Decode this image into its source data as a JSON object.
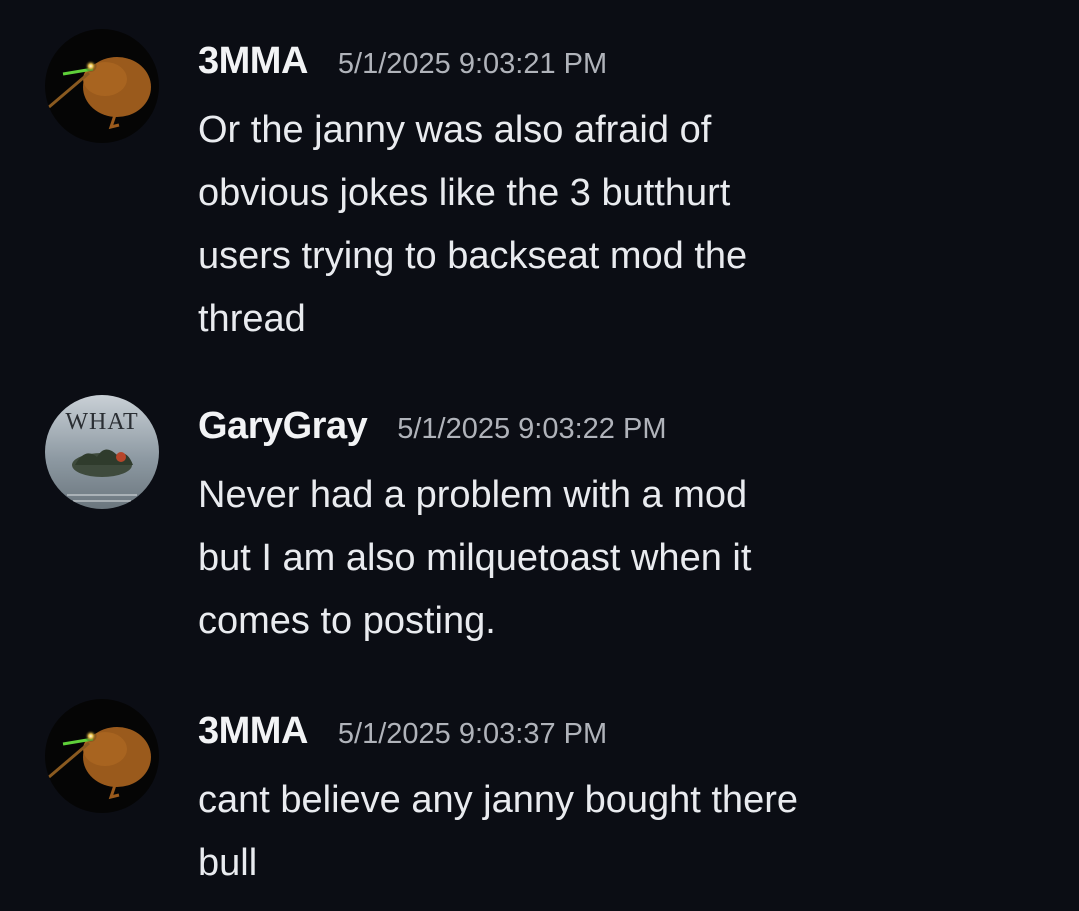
{
  "messages": [
    {
      "username": "3MMA",
      "timestamp": "5/1/2025 9:03:21 PM",
      "avatar_icon": "kiwi-bird-avatar-icon",
      "lines": [
        "Or the janny was also afraid of",
        "obvious jokes like the 3 butthurt",
        "users trying to backseat mod the",
        "thread"
      ]
    },
    {
      "username": "GaryGray",
      "timestamp": "5/1/2025 9:03:22 PM",
      "avatar_icon": "what-album-cover-avatar-icon",
      "avatar_text": "WHAT",
      "lines": [
        "Never had a problem with a mod",
        "but I am also milquetoast when it",
        "comes to posting."
      ]
    },
    {
      "username": "3MMA",
      "timestamp": "5/1/2025 9:03:37 PM",
      "avatar_icon": "kiwi-bird-avatar-icon",
      "lines": [
        "cant believe any janny bought there",
        "bull"
      ]
    }
  ],
  "colors": {
    "background": "#0b0d14",
    "username": "#f2f3f5",
    "timestamp": "#b0b3ba",
    "text": "#e9ebef"
  }
}
